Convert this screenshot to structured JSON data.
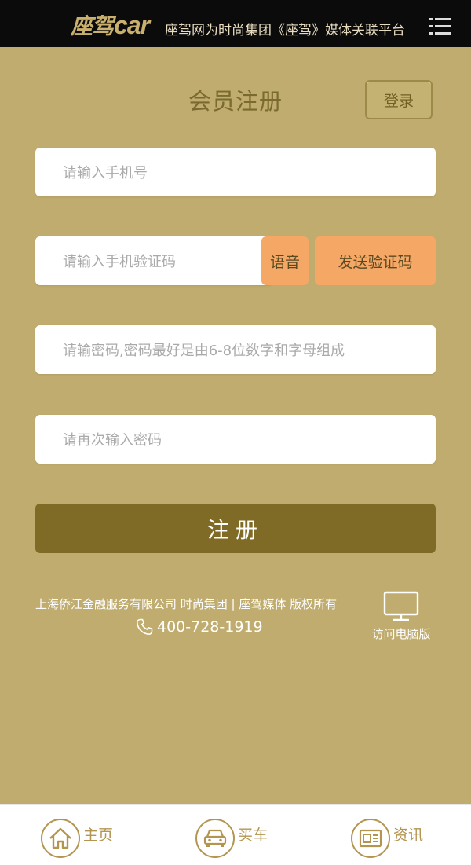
{
  "header": {
    "logo_cn": "座驾",
    "logo_en": "car",
    "slogan": "座驾网为时尚集团《座驾》媒体关联平台",
    "menu_icon": "menu-icon"
  },
  "page": {
    "title": "会员注册",
    "login_label": "登录"
  },
  "form": {
    "phone_placeholder": "请输入手机号",
    "code_placeholder": "请输入手机验证码",
    "voice_label": "语音",
    "send_code_label": "发送验证码",
    "password_placeholder": "请输密码,密码最好是由6-8位数字和字母组成",
    "confirm_placeholder": "请再次输入密码",
    "submit_label": "注册"
  },
  "footer": {
    "copyright": "上海侨江金融服务有限公司 时尚集团 | 座驾媒体 版权所有",
    "phone": "400-728-1919",
    "pc_link": "访问电脑版"
  },
  "nav": {
    "items": [
      {
        "label": "主页",
        "icon": "home-icon"
      },
      {
        "label": "买车",
        "icon": "car-icon"
      },
      {
        "label": "资讯",
        "icon": "news-icon"
      }
    ]
  },
  "colors": {
    "background": "#bfac6e",
    "header": "#0b0b0b",
    "accent_orange": "#f5a766",
    "primary_button": "#7f6a26",
    "nav_gold": "#b39550"
  }
}
